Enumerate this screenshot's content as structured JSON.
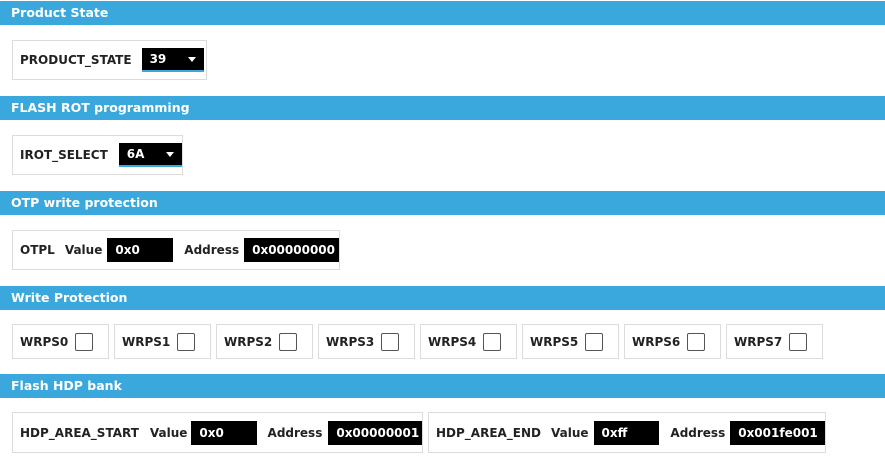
{
  "product_state": {
    "header": "Product State",
    "label": "PRODUCT_STATE",
    "value": "39"
  },
  "flash_rot": {
    "header": "FLASH ROT programming",
    "label": "IROT_SELECT",
    "value": "6A"
  },
  "otp": {
    "header": "OTP write protection",
    "label": "OTPL",
    "value_label": "Value",
    "value": "0x0",
    "address_label": "Address",
    "address": "0x00000000"
  },
  "write_protection": {
    "header": "Write Protection",
    "items": [
      {
        "label": "WRPS0",
        "checked": false
      },
      {
        "label": "WRPS1",
        "checked": false
      },
      {
        "label": "WRPS2",
        "checked": false
      },
      {
        "label": "WRPS3",
        "checked": false
      },
      {
        "label": "WRPS4",
        "checked": false
      },
      {
        "label": "WRPS5",
        "checked": false
      },
      {
        "label": "WRPS6",
        "checked": false
      },
      {
        "label": "WRPS7",
        "checked": false
      }
    ]
  },
  "hdp": {
    "header": "Flash HDP bank",
    "start": {
      "label": "HDP_AREA_START",
      "value_label": "Value",
      "value": "0x0",
      "address_label": "Address",
      "address": "0x00000001"
    },
    "end": {
      "label": "HDP_AREA_END",
      "value_label": "Value",
      "value": "0xff",
      "address_label": "Address",
      "address": "0x001fe001"
    }
  },
  "colors": {
    "header_bg": "#3aa8dc",
    "field_bg": "#000000",
    "field_text": "#ffffff"
  }
}
